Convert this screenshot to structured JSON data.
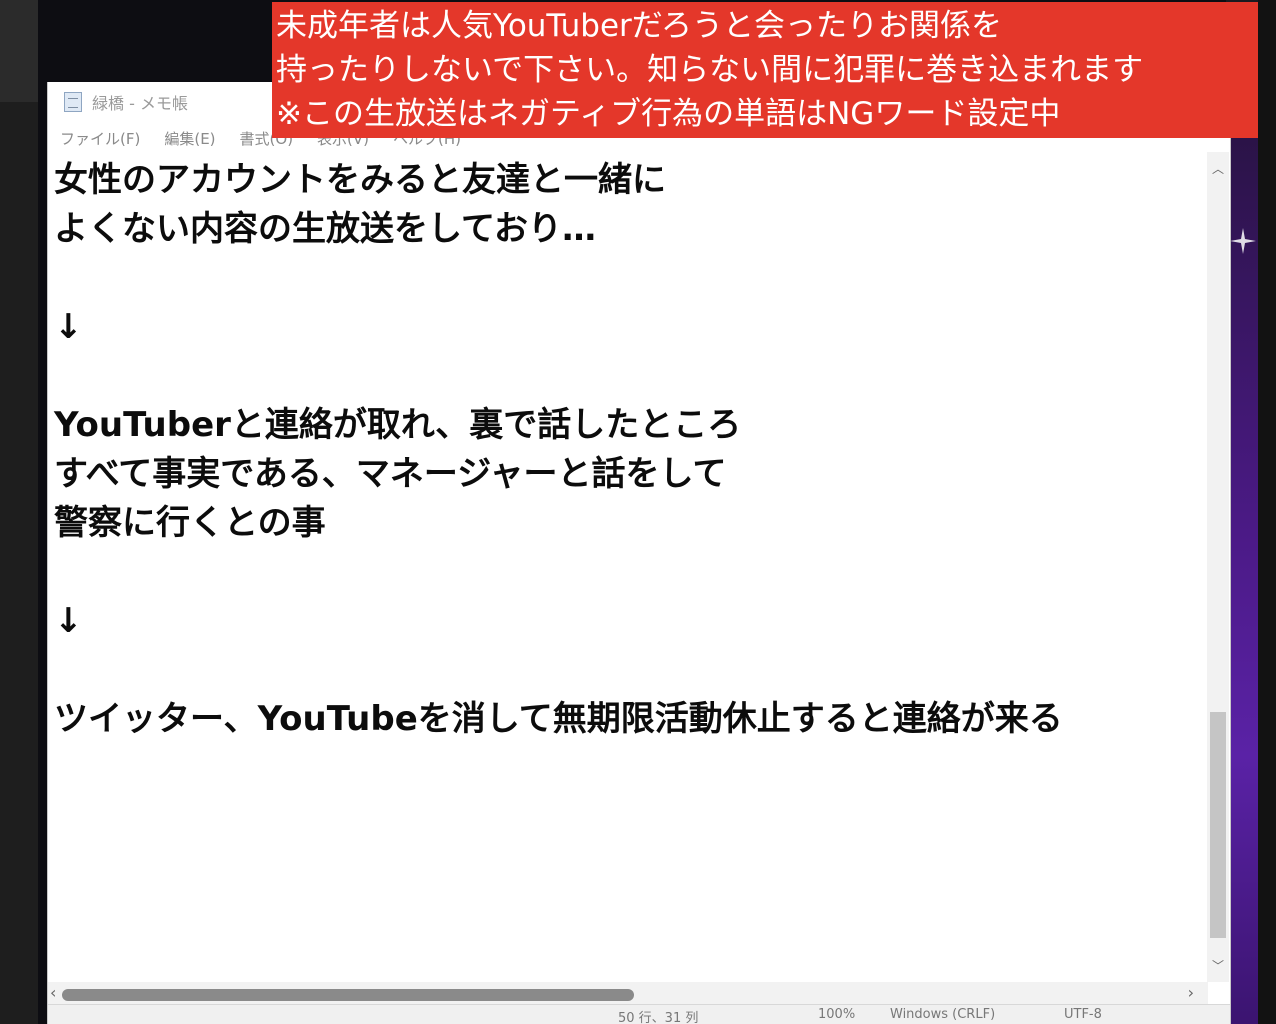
{
  "window": {
    "title": "緑橋 - メモ帳",
    "menu": [
      "ファイル(F)",
      "編集(E)",
      "書式(O)",
      "表示(V)",
      "ヘルプ(H)"
    ]
  },
  "banner": {
    "lines": [
      "未成年者は人気YouTuberだろうと会ったりお関係を",
      "持ったりしないで下さい。知らない間に犯罪に巻き込まれます",
      "※この生放送はネガティブ行為の単語はNGワード設定中"
    ]
  },
  "document": {
    "lines": [
      "女性のアカウントをみると友達と一緒に",
      "よくない内容の生放送をしており…",
      "",
      "↓",
      "",
      "YouTuberと連絡が取れ、裏で話したところ",
      "すべて事実である、マネージャーと話をして",
      "警察に行くとの事",
      "",
      "↓",
      "",
      "ツイッター、YouTubeを消して無期限活動休止すると連絡が来る"
    ]
  },
  "statusbar": {
    "position": "50 行、31 列",
    "zoom": "100%",
    "eol": "Windows (CRLF)",
    "encoding": "UTF-8"
  },
  "icons": {
    "scroll_up": "chevron-up-icon",
    "scroll_down": "chevron-down-icon",
    "scroll_right": "chevron-right-icon",
    "app": "notepad-icon"
  },
  "colors": {
    "banner_bg": "#e4372a",
    "banner_text": "#ffffff",
    "editor_text": "#0c0c0c"
  }
}
